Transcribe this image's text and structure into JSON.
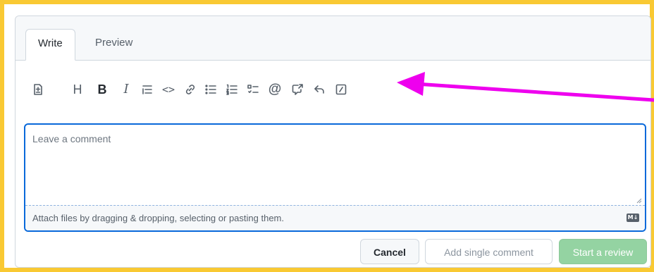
{
  "tabs": [
    {
      "label": "Write",
      "active": true
    },
    {
      "label": "Preview",
      "active": false
    }
  ],
  "toolbar": {
    "heading_glyph": "H",
    "bold_glyph": "B",
    "italic_glyph": "I",
    "code_glyph": "<>",
    "mention_glyph": "@",
    "icons": [
      "add-file-icon",
      "heading-icon",
      "bold-icon",
      "italic-icon",
      "quote-icon",
      "code-icon",
      "link-icon",
      "unordered-list-icon",
      "ordered-list-icon",
      "task-list-icon",
      "mention-icon",
      "cross-reference-icon",
      "reply-icon",
      "slash-commands-icon"
    ]
  },
  "editor": {
    "placeholder": "Leave a comment",
    "value": "",
    "attach_hint": "Attach files by dragging & dropping, selecting or pasting them.",
    "markdown_badge": "M↓"
  },
  "actions": {
    "cancel_label": "Cancel",
    "single_label": "Add single comment",
    "review_label": "Start a review"
  },
  "colors": {
    "highlight_border": "#f9c933",
    "focus_border": "#0969da",
    "annotation_arrow": "#ee00ee",
    "review_button": "#94d3a2"
  }
}
